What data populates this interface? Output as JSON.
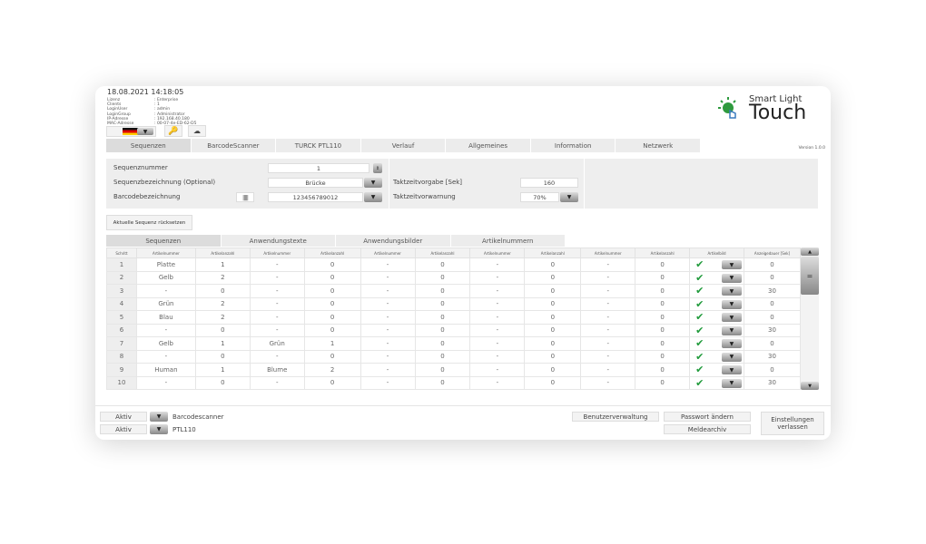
{
  "header": {
    "datetime": "18.08.2021 14:18:05",
    "info": [
      [
        "Lizenz",
        ": Enterprise"
      ],
      [
        "Clients",
        ": 1"
      ],
      [
        "LoginUser",
        ": admin"
      ],
      [
        "LoginGroup",
        ": Administrator"
      ],
      [
        "IP-Adresse",
        ": 192.168.40.180"
      ],
      [
        "MAC-Adresse",
        ": 00-07-4e-ED-62-D5"
      ]
    ],
    "logo": {
      "line1": "Smart Light",
      "line2": "Touch"
    },
    "version": "Version 1.0.0"
  },
  "tabs": [
    "Sequenzen",
    "BarcodeScanner",
    "TURCK PTL110",
    "Verlauf",
    "Allgemeines",
    "Information",
    "Netzwerk"
  ],
  "form": {
    "seq_nr_label": "Sequenznummer",
    "seq_nr": "1",
    "seq_name_label": "Sequenzbezeichnung (Optional)",
    "seq_name": "Brücke",
    "barcode_label": "Barcodebezeichnung",
    "barcode": "123456789012",
    "takt_label": "Taktzeitvorgabe [Sek]",
    "takt": "160",
    "warn_label": "Taktzeitvorwarnung",
    "warn": "70%"
  },
  "reset_button": "Aktuelle Sequenz rücksetzen",
  "subtabs": [
    "Sequenzen",
    "Anwendungstexte",
    "Anwendungsbilder",
    "Artikelnummern"
  ],
  "table": {
    "headers": [
      "Schritt",
      "Artikelnummer",
      "Artikelanzahl",
      "Artikelnummer",
      "Artikelanzahl",
      "Artikelnummer",
      "Artikelanzahl",
      "Artikelnummer",
      "Artikelanzahl",
      "Artikelnummer",
      "Artikelanzahl",
      "Artikelbild",
      "Anzeigedauer [Sek]"
    ],
    "rows": [
      [
        "1",
        "Platte",
        "1",
        "-",
        "0",
        "-",
        "0",
        "-",
        "0",
        "-",
        "0",
        "0"
      ],
      [
        "2",
        "Gelb",
        "2",
        "-",
        "0",
        "-",
        "0",
        "-",
        "0",
        "-",
        "0",
        "0"
      ],
      [
        "3",
        "-",
        "0",
        "-",
        "0",
        "-",
        "0",
        "-",
        "0",
        "-",
        "0",
        "30"
      ],
      [
        "4",
        "Grün",
        "2",
        "-",
        "0",
        "-",
        "0",
        "-",
        "0",
        "-",
        "0",
        "0"
      ],
      [
        "5",
        "Blau",
        "2",
        "-",
        "0",
        "-",
        "0",
        "-",
        "0",
        "-",
        "0",
        "0"
      ],
      [
        "6",
        "-",
        "0",
        "-",
        "0",
        "-",
        "0",
        "-",
        "0",
        "-",
        "0",
        "30"
      ],
      [
        "7",
        "Gelb",
        "1",
        "Grün",
        "1",
        "-",
        "0",
        "-",
        "0",
        "-",
        "0",
        "0"
      ],
      [
        "8",
        "-",
        "0",
        "-",
        "0",
        "-",
        "0",
        "-",
        "0",
        "-",
        "0",
        "30"
      ],
      [
        "9",
        "Human",
        "1",
        "Blume",
        "2",
        "-",
        "0",
        "-",
        "0",
        "-",
        "0",
        "0"
      ],
      [
        "10",
        "-",
        "0",
        "-",
        "0",
        "-",
        "0",
        "-",
        "0",
        "-",
        "0",
        "30"
      ]
    ]
  },
  "bottom": {
    "status1": "Aktiv",
    "dev1": "Barcodescanner",
    "status2": "Aktiv",
    "dev2": "PTL110",
    "user_mgmt": "Benutzerverwaltung",
    "change_pw": "Passwort ändern",
    "archive": "Meldearchiv",
    "exit": "Einstellungen verlassen"
  },
  "colors": {
    "check": "#1f9a3a",
    "logo_green": "#2e9a3e"
  }
}
